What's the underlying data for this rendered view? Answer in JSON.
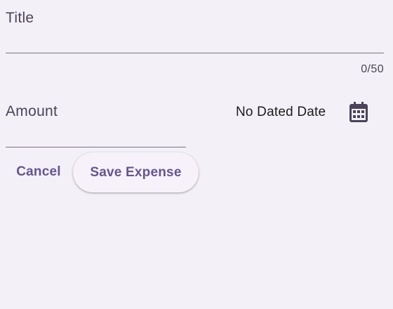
{
  "form": {
    "title_field": {
      "label": "Title",
      "value": "",
      "counter": "0/50"
    },
    "amount_field": {
      "label": "Amount",
      "value": ""
    },
    "date": {
      "text": "No Dated Date",
      "icon": "calendar-icon"
    },
    "actions": {
      "cancel_label": "Cancel",
      "save_label": "Save Expense"
    }
  },
  "colors": {
    "background": "#f4f0f8",
    "accent": "#65558f",
    "label": "#4a4458",
    "underline": "#79747e",
    "icon": "#4a4458"
  }
}
